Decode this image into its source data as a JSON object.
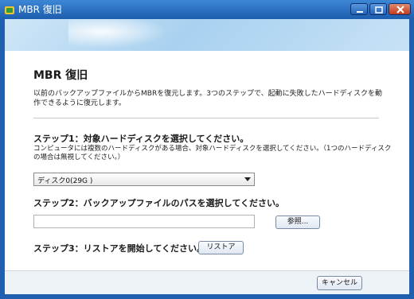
{
  "window": {
    "title": "MBR 復旧"
  },
  "page": {
    "title": "MBR 復旧",
    "description": "以前のバックアップファイルからMBRを復元します。3つのステップで、起動に失敗したハードディスクを動作できるように復元します。"
  },
  "step1": {
    "label": "ステップ1：対象ハードディスクを選択してください。",
    "description": "コンピュータには複数のハードディスクがある場合、対象ハードディスクを選択してください。（1つのハードディスクの場合は無視してください。）",
    "selected_disk": "ディスク0(29G )"
  },
  "step2": {
    "label": "ステップ2：バックアップファイルのパスを選択してください。",
    "path_value": "",
    "browse_label": "参照..."
  },
  "step3": {
    "label": "ステップ3：リストアを開始してください。",
    "restore_label": "リストア"
  },
  "footer": {
    "cancel_label": "キャンセル"
  },
  "icons": {
    "app": "app-logo-icon",
    "minimize": "minimize-icon",
    "maximize": "maximize-icon",
    "close": "close-icon",
    "dropdown": "chevron-down-icon"
  },
  "colors": {
    "titlebar": "#1d5eae",
    "header": "#a9d1ef",
    "close_button": "#c43a1c"
  }
}
